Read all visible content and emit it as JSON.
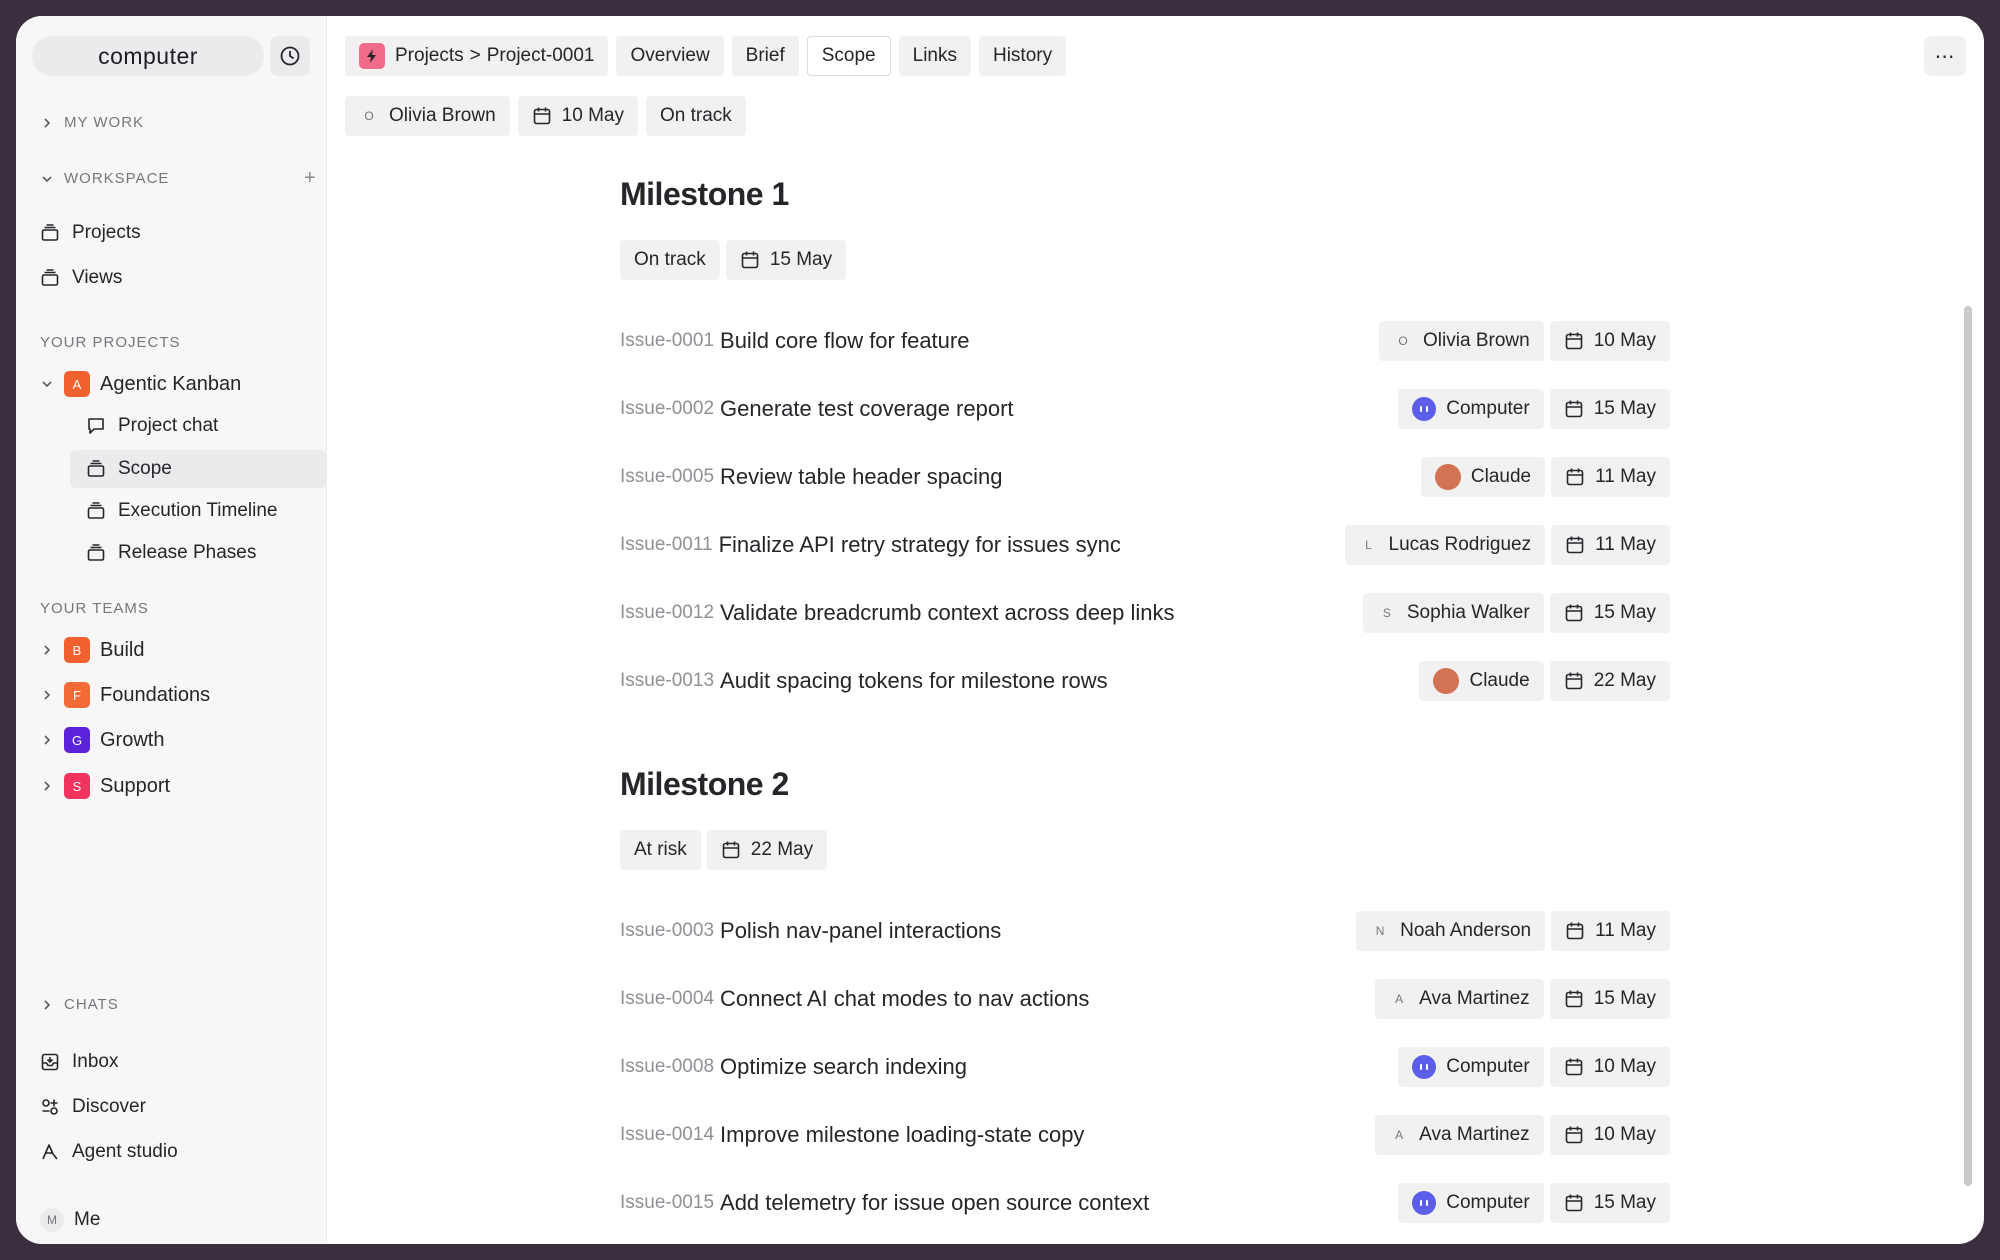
{
  "app": {
    "logo": "computer"
  },
  "sidebar": {
    "my_work": "MY WORK",
    "workspace": "WORKSPACE",
    "workspace_items": [
      {
        "label": "Projects",
        "icon": "stack-icon"
      },
      {
        "label": "Views",
        "icon": "stack-icon"
      }
    ],
    "your_projects": "YOUR PROJECTS",
    "project": {
      "badge": "A",
      "label": "Agentic Kanban",
      "color": "#f0612f",
      "children": [
        {
          "label": "Project chat",
          "icon": "chat-icon"
        },
        {
          "label": "Scope",
          "icon": "stack-icon",
          "active": true
        },
        {
          "label": "Execution Timeline",
          "icon": "stack-icon"
        },
        {
          "label": "Release Phases",
          "icon": "stack-icon"
        }
      ]
    },
    "your_teams": "YOUR TEAMS",
    "teams": [
      {
        "badge": "B",
        "label": "Build",
        "color": "#f0612f"
      },
      {
        "badge": "F",
        "label": "Foundations",
        "color": "#f26a35"
      },
      {
        "badge": "G",
        "label": "Growth",
        "color": "#5a23d9"
      },
      {
        "badge": "S",
        "label": "Support",
        "color": "#f0345e"
      }
    ],
    "chats": "CHATS",
    "bottom_items": [
      {
        "label": "Inbox",
        "icon": "inbox-icon"
      },
      {
        "label": "Discover",
        "icon": "discover-icon"
      },
      {
        "label": "Agent studio",
        "icon": "agent-studio-icon"
      }
    ],
    "me": {
      "avatar": "M",
      "label": "Me"
    }
  },
  "header": {
    "breadcrumb": {
      "root": "Projects",
      "separator": ">",
      "current": "Project-0001"
    },
    "tabs": [
      {
        "label": "Overview",
        "selected": false
      },
      {
        "label": "Brief",
        "selected": false
      },
      {
        "label": "Scope",
        "selected": true
      },
      {
        "label": "Links",
        "selected": false
      },
      {
        "label": "History",
        "selected": false
      }
    ],
    "more": "⋯",
    "owner": {
      "avatar": "O",
      "name": "Olivia Brown"
    },
    "date": "10 May",
    "status": "On track"
  },
  "milestones": [
    {
      "title": "Milestone 1",
      "status": "On track",
      "date": "15 May",
      "issues": [
        {
          "id": "Issue-0001",
          "title": "Build core flow for feature",
          "assignee": "Olivia Brown",
          "avatar": "O",
          "kind": "letter",
          "date": "10 May"
        },
        {
          "id": "Issue-0002",
          "title": "Generate test coverage report",
          "assignee": "Computer",
          "avatar": "",
          "kind": "ai",
          "date": "15 May"
        },
        {
          "id": "Issue-0005",
          "title": "Review table header spacing",
          "assignee": "Claude",
          "avatar": "",
          "kind": "claude",
          "date": "11 May"
        },
        {
          "id": "Issue-0011",
          "title": "Finalize API retry strategy for issues sync",
          "assignee": "Lucas Rodriguez",
          "avatar": "L",
          "kind": "letter",
          "date": "11 May"
        },
        {
          "id": "Issue-0012",
          "title": "Validate breadcrumb context across deep links",
          "assignee": "Sophia Walker",
          "avatar": "S",
          "kind": "letter",
          "date": "15 May"
        },
        {
          "id": "Issue-0013",
          "title": "Audit spacing tokens for milestone rows",
          "assignee": "Claude",
          "avatar": "",
          "kind": "claude",
          "date": "22 May"
        }
      ]
    },
    {
      "title": "Milestone 2",
      "status": "At risk",
      "date": "22 May",
      "issues": [
        {
          "id": "Issue-0003",
          "title": "Polish nav-panel interactions",
          "assignee": "Noah Anderson",
          "avatar": "N",
          "kind": "letter",
          "date": "11 May"
        },
        {
          "id": "Issue-0004",
          "title": "Connect AI chat modes to nav actions",
          "assignee": "Ava Martinez",
          "avatar": "A",
          "kind": "letter",
          "date": "15 May"
        },
        {
          "id": "Issue-0008",
          "title": "Optimize search indexing",
          "assignee": "Computer",
          "avatar": "",
          "kind": "ai",
          "date": "10 May"
        },
        {
          "id": "Issue-0014",
          "title": "Improve milestone loading-state copy",
          "assignee": "Ava Martinez",
          "avatar": "A",
          "kind": "letter",
          "date": "10 May"
        },
        {
          "id": "Issue-0015",
          "title": "Add telemetry for issue open source context",
          "assignee": "Computer",
          "avatar": "",
          "kind": "ai",
          "date": "15 May"
        }
      ]
    }
  ],
  "colors": {
    "accent_ai": "#5b5ee8",
    "claude": "#d27353",
    "crumb_icon": "#f26b8a"
  }
}
